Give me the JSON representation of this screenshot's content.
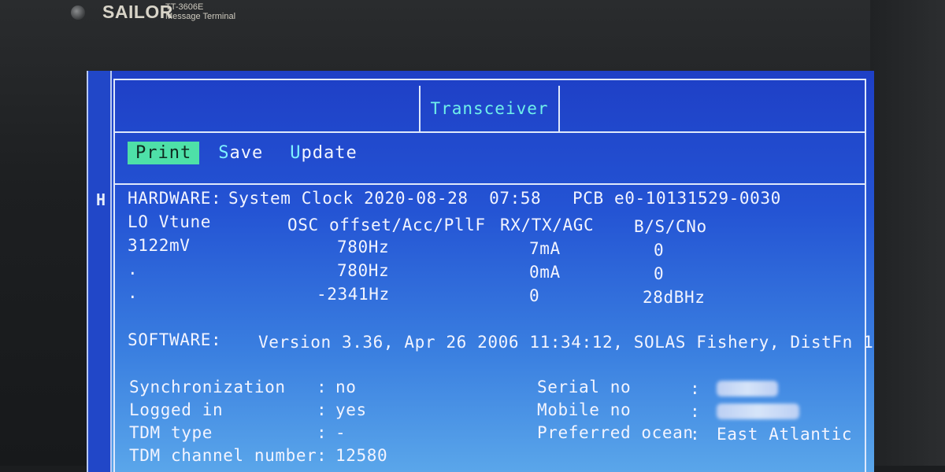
{
  "device": {
    "brand": "SAILOR",
    "model": "TT-3606E",
    "subtitle": "Message Terminal"
  },
  "screen": {
    "side_label": "H",
    "title": "Transceiver",
    "menu": [
      {
        "label": "Print",
        "selected": true
      },
      {
        "hot": "S",
        "rest": "ave",
        "selected": false
      },
      {
        "hot": "U",
        "rest": "pdate",
        "selected": false
      }
    ],
    "hardware": {
      "label": "HARDWARE:",
      "line": "System Clock 2020-08-28  07:58   PCB e0-10131529-0030",
      "columns": [
        "LO Vtune",
        "OSC offset/Acc/PllF",
        "RX/TX/AGC",
        "B/S/CNo"
      ],
      "rows": [
        [
          "3122mV",
          "780Hz",
          "7mA",
          "0"
        ],
        [
          ".",
          "780Hz",
          "0mA",
          "0"
        ],
        [
          ".",
          "-2341Hz",
          "0",
          "28dBHz"
        ]
      ]
    },
    "software": {
      "label": "SOFTWARE:",
      "value": "Version 3.36, Apr 26 2006 11:34:12, SOLAS Fishery, DistFn 1"
    },
    "status_left": [
      {
        "label": "Synchronization",
        "value": "no"
      },
      {
        "label": "Logged in",
        "value": "yes"
      },
      {
        "label": "TDM type",
        "value": "-"
      },
      {
        "label": "TDM channel number",
        "value": "12580"
      }
    ],
    "status_right": [
      {
        "label": "Serial no",
        "value": ""
      },
      {
        "label": "Mobile no",
        "value": ""
      },
      {
        "label": "Preferred ocean",
        "value": "East Atlantic"
      }
    ]
  }
}
